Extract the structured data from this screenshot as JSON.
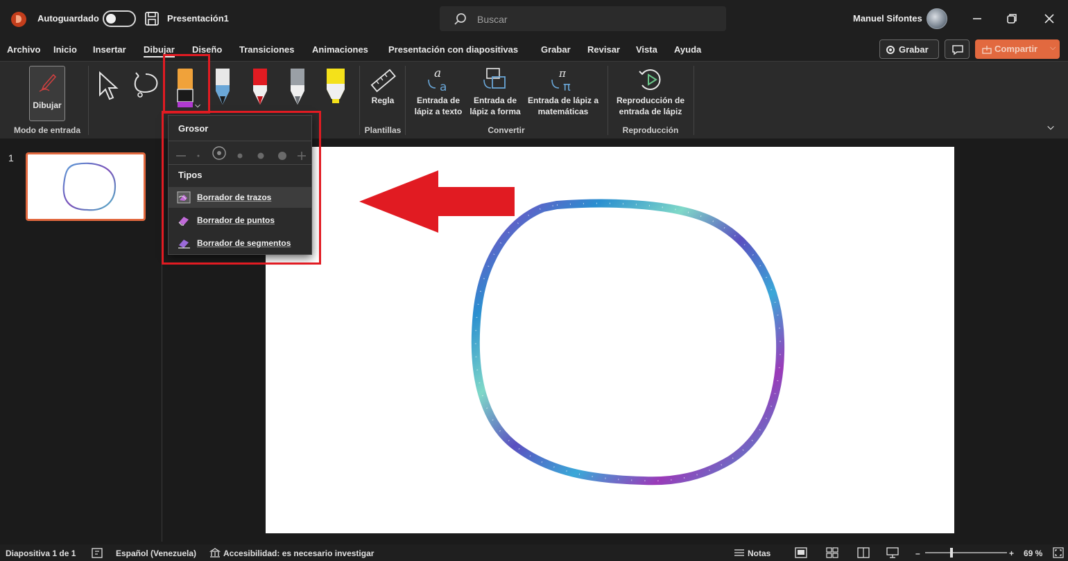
{
  "titlebar": {
    "autosave_label": "Autoguardado",
    "document_title": "Presentación1",
    "search_placeholder": "Buscar",
    "user_name": "Manuel Sifontes"
  },
  "menu": {
    "tabs": [
      "Archivo",
      "Inicio",
      "Insertar",
      "Dibujar",
      "Diseño",
      "Transiciones",
      "Animaciones",
      "Presentación con diapositivas",
      "Grabar",
      "Revisar",
      "Vista",
      "Ayuda"
    ],
    "active_tab": "Dibujar",
    "record_label": "Grabar",
    "share_label": "Compartir"
  },
  "ribbon": {
    "draw_label": "Dibujar",
    "group_input_mode": "Modo de entrada",
    "ruler_label": "Regla",
    "group_stencils": "Plantillas",
    "ink_to_text": "Entrada de lápiz a texto",
    "ink_to_shape": "Entrada de lápiz a forma",
    "ink_to_math": "Entrada de lápiz a matemáticas",
    "group_convert": "Convertir",
    "ink_replay": "Reproducción de entrada de lápiz",
    "group_replay": "Reproducción",
    "pen_colors": [
      "#e8e8e8",
      "#e11b22",
      "#9aa0a6",
      "#f4e11a"
    ],
    "eraser_color": "#f0a23a"
  },
  "eraser_menu": {
    "thickness_heading": "Grosor",
    "types_heading": "Tipos",
    "items": [
      "Borrador de trazos",
      "Borrador de puntos",
      "Borrador de segmentos"
    ],
    "hover_item": "Borrador de trazos"
  },
  "slides": {
    "current_number": "1"
  },
  "statusbar": {
    "slide_info": "Diapositiva 1 de 1",
    "language": "Español (Venezuela)",
    "accessibility": "Accesibilidad: es necesario investigar",
    "notes_label": "Notas",
    "zoom": "69 %"
  },
  "colors": {
    "accent": "#e2693f",
    "annotation_red": "#e11b22"
  }
}
